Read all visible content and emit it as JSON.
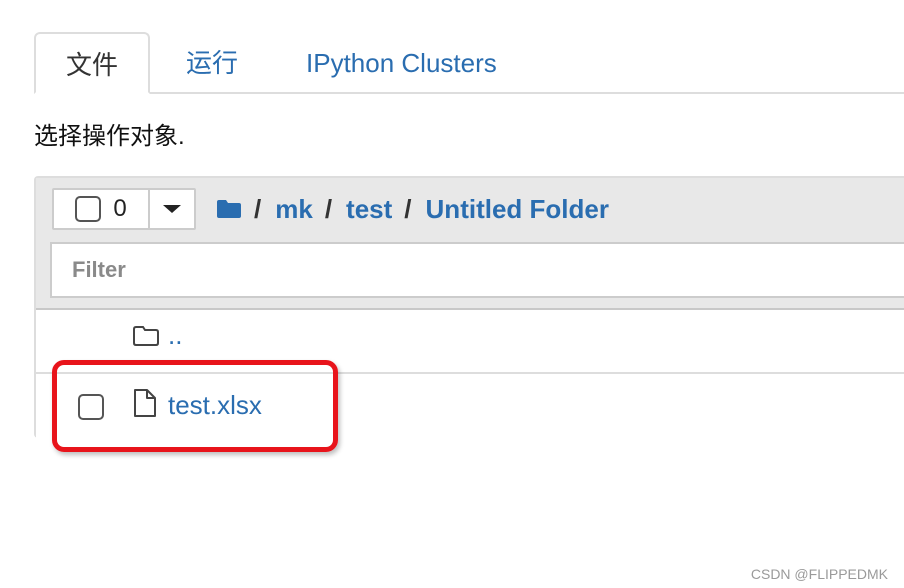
{
  "tabs": [
    {
      "label": "文件",
      "active": true
    },
    {
      "label": "运行",
      "active": false
    },
    {
      "label": "IPython Clusters",
      "active": false
    }
  ],
  "instructions": "选择操作对象.",
  "toolbar": {
    "selected_count": "0",
    "dropdown_icon": "caret-down-icon"
  },
  "breadcrumb": {
    "root_icon": "folder-icon",
    "separator": "/",
    "items": [
      "mk",
      "test",
      "Untitled Folder"
    ]
  },
  "filter": {
    "placeholder": "Filter",
    "value": ""
  },
  "files": [
    {
      "name": "..",
      "type": "parent-directory",
      "icon": "folder-outline-icon",
      "has_checkbox": false
    },
    {
      "name": "test.xlsx",
      "type": "file",
      "icon": "file-outline-icon",
      "has_checkbox": true
    }
  ],
  "annotation": {
    "color": "#e8141b",
    "target": "test.xlsx"
  },
  "watermark": "CSDN @FLIPPEDMK",
  "colors": {
    "link": "#2a6db0",
    "panel_header": "#e8e8e8",
    "border": "#dddddd"
  }
}
